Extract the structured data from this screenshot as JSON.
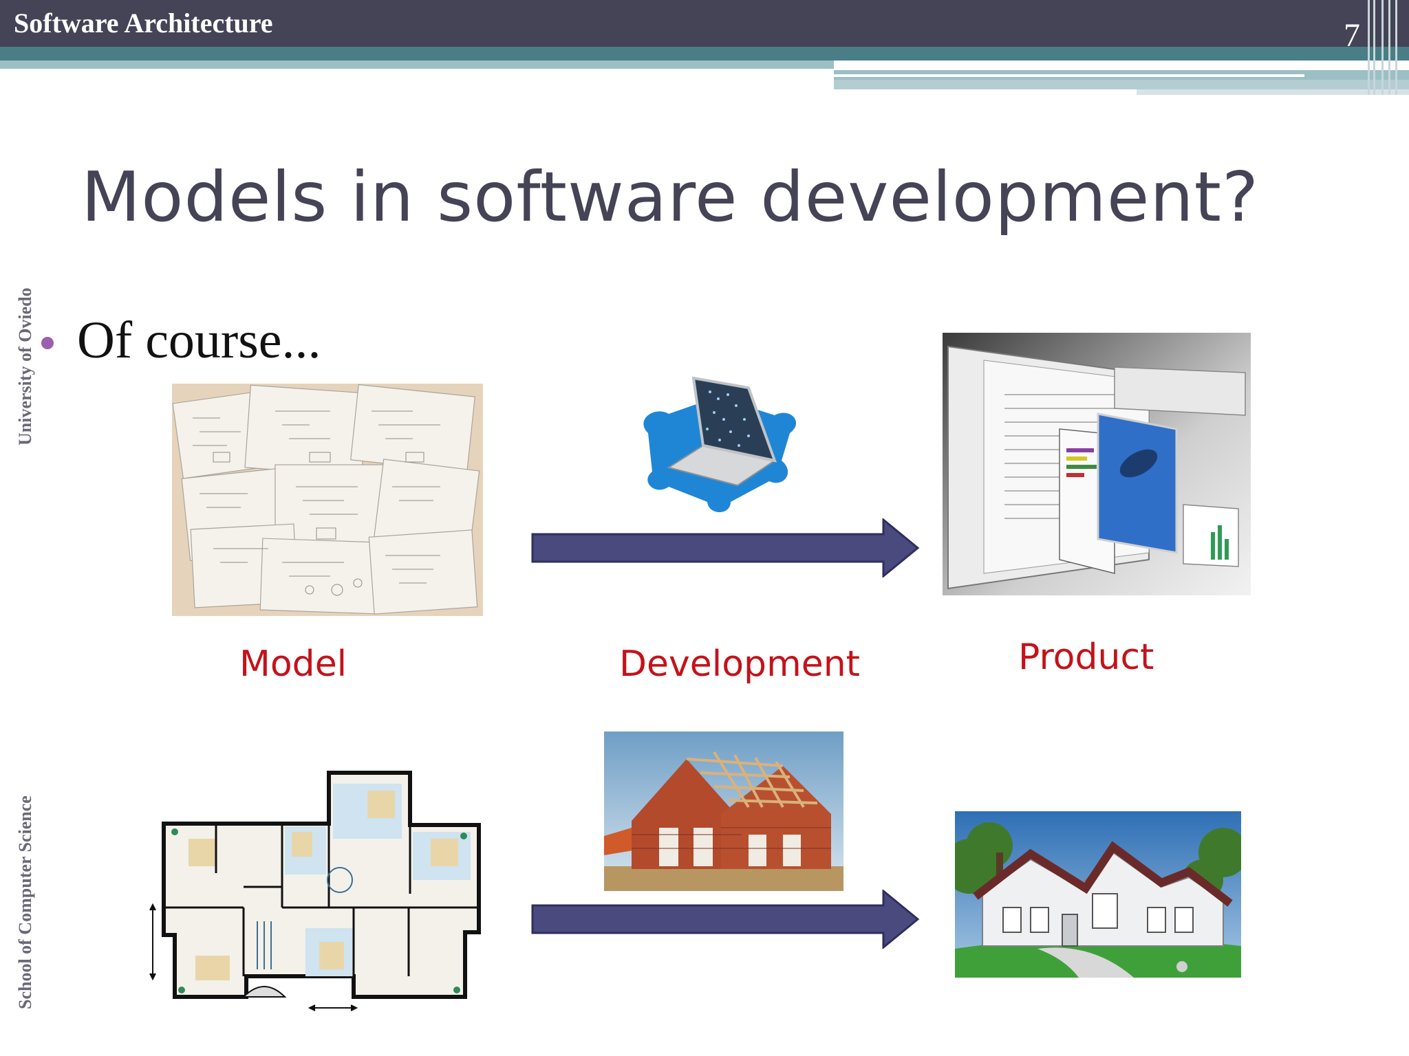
{
  "header": {
    "title": "Software Architecture",
    "slide_number": "7"
  },
  "slide": {
    "title": "Models in software development?",
    "bullet": "Of course...",
    "side_label_top": "University of Oviedo",
    "side_label_bottom": "School of Computer Science"
  },
  "captions": {
    "model": "Model",
    "development": "Development",
    "product": "Product"
  },
  "colors": {
    "header_bg": "#454356",
    "stripe_teal": "#4a7e86",
    "stripe_light": "#9bbfc4",
    "arrow": "#4b4a7e",
    "caption": "#c4121a",
    "bullet": "#9a5fad"
  }
}
